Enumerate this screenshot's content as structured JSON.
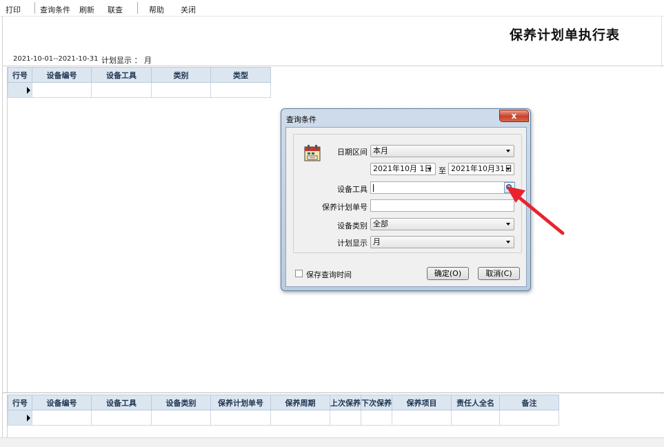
{
  "toolbar": {
    "print": "打印",
    "query": "查询条件",
    "refresh": "刷新",
    "lookup": "联查",
    "help": "帮助",
    "close": "关闭"
  },
  "report": {
    "title": "保养计划单执行表",
    "date_range": "2021-10-01--2021-10-31",
    "plan_display": "计划显示 ： 月"
  },
  "top_grid": {
    "columns": [
      "行号",
      "设备编号",
      "设备工具",
      "类别",
      "类型"
    ]
  },
  "bottom_grid": {
    "columns": [
      "行号",
      "设备编号",
      "设备工具",
      "设备类别",
      "保养计划单号",
      "保养周期",
      "上次保养",
      "下次保养",
      "保养项目",
      "责任人全名",
      "备注"
    ]
  },
  "dialog": {
    "title": "查询条件",
    "close_glyph": "x",
    "date_range_label": "日期区间",
    "date_range_value": "本月",
    "start_date": "2021年10月 1日",
    "to_label": "至",
    "end_date": "2021年10月31日",
    "equipment_label": "设备工具",
    "equipment_value": "",
    "plan_no_label": "保养计划单号",
    "plan_no_value": "",
    "category_label": "设备类别",
    "category_value": "全部",
    "plan_display_label": "计划显示",
    "plan_display_value": "月",
    "save_time_label": "保存查询时间",
    "save_time_checked": false,
    "ok_button": "确定(O)",
    "cancel_button": "取消(C)"
  },
  "annotation": {
    "arrow_color": "#e8232f"
  },
  "icons": {
    "calendar": "calendar-icon",
    "browse": "magnifier-icon",
    "row_indicator": "row-pointer-icon"
  }
}
